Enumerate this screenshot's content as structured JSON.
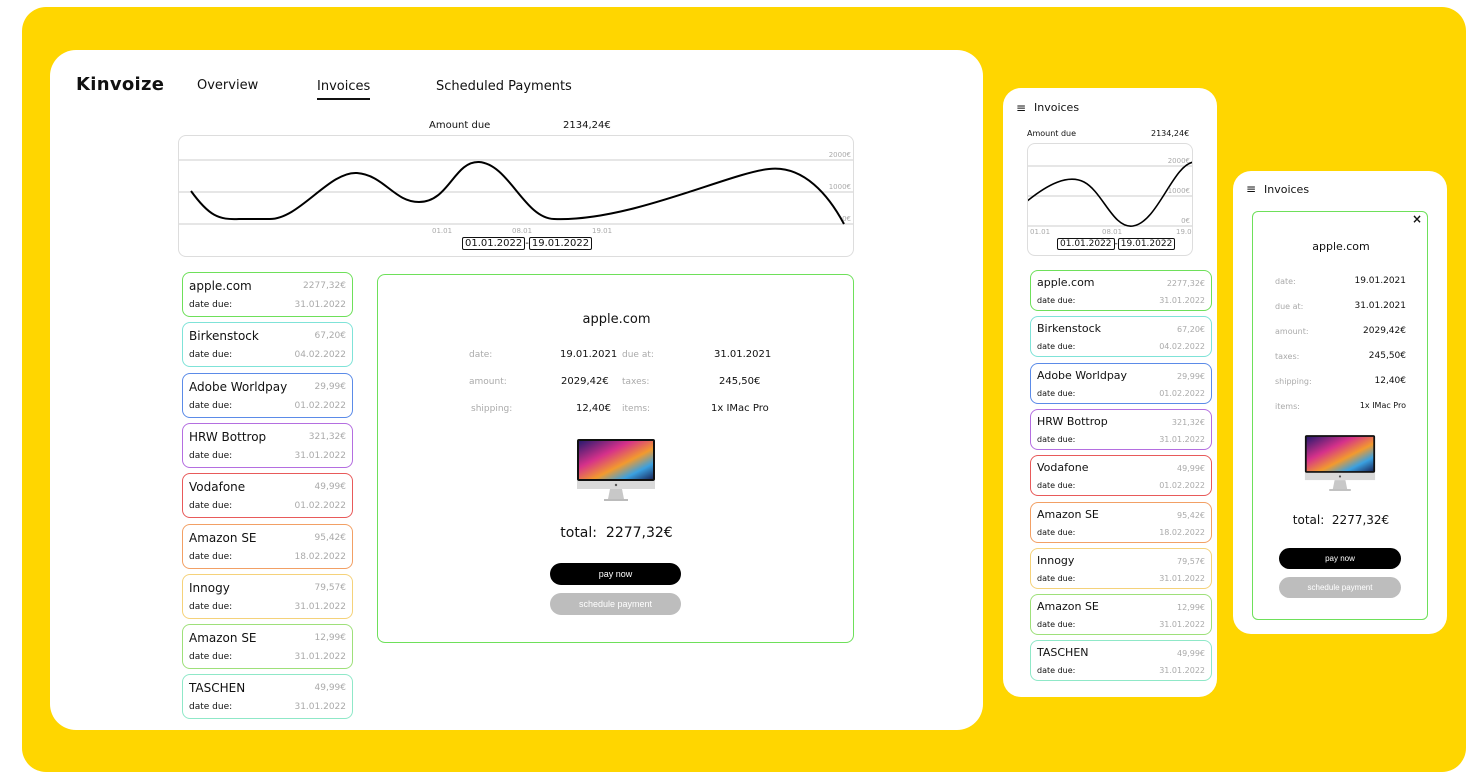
{
  "app": {
    "brand": "Kinvoize"
  },
  "nav": {
    "overview": "Overview",
    "invoices": "Invoices",
    "scheduled": "Scheduled Payments"
  },
  "summary": {
    "label": "Amount due",
    "value": "2134,24€"
  },
  "chart": {
    "y_ticks": [
      "2000€",
      "1000€",
      "0€"
    ],
    "x_ticks": [
      "01.01",
      "08.01",
      "19.01"
    ],
    "date_from": "01.01.2022",
    "date_sep": "-",
    "date_to": "19.01.2022"
  },
  "invoices": [
    {
      "name": "apple.com",
      "amount": "2277,32€",
      "date_label": "date due:",
      "date": "31.01.2022",
      "color": "#6ee05a"
    },
    {
      "name": "Birkenstock",
      "amount": "67,20€",
      "date_label": "date due:",
      "date": "04.02.2022",
      "color": "#7fe3d8"
    },
    {
      "name": "Adobe Worldpay",
      "amount": "29,99€",
      "date_label": "date due:",
      "date": "01.02.2022",
      "color": "#5b8be8"
    },
    {
      "name": "HRW Bottrop",
      "amount": "321,32€",
      "date_label": "date due:",
      "date": "31.01.2022",
      "color": "#b46ee0"
    },
    {
      "name": "Vodafone",
      "amount": "49,99€",
      "date_label": "date due:",
      "date": "01.02.2022",
      "color": "#e85a5a"
    },
    {
      "name": "Amazon SE",
      "amount": "95,42€",
      "date_label": "date due:",
      "date": "18.02.2022",
      "color": "#f2a065"
    },
    {
      "name": "Innogy",
      "amount": "79,57€",
      "date_label": "date due:",
      "date": "31.01.2022",
      "color": "#f5d27a"
    },
    {
      "name": "Amazon SE",
      "amount": "12,99€",
      "date_label": "date due:",
      "date": "31.01.2022",
      "color": "#9ee07a"
    },
    {
      "name": "TASCHEN",
      "amount": "49,99€",
      "date_label": "date due:",
      "date": "31.01.2022",
      "color": "#8fe8c8"
    }
  ],
  "detail": {
    "title": "apple.com",
    "date_label": "date:",
    "date": "19.01.2021",
    "due_label": "due at:",
    "due": "31.01.2021",
    "amount_label": "amount:",
    "amount": "2029,42€",
    "taxes_label": "taxes:",
    "taxes": "245,50€",
    "shipping_label": "shipping:",
    "shipping": "12,40€",
    "items_label": "items:",
    "items": "1x IMac Pro",
    "total_label": "total:",
    "total": "2277,32€",
    "pay_label": "pay now",
    "schedule_label": "schedule payment",
    "close": "×"
  },
  "mobile": {
    "title": "Invoices",
    "menu_icon": "hamburger-icon"
  },
  "colors": {
    "background": "#FFD600",
    "accent": "#6ee05a",
    "primary_button": "#000000",
    "secondary_button": "#bdbdbd"
  }
}
